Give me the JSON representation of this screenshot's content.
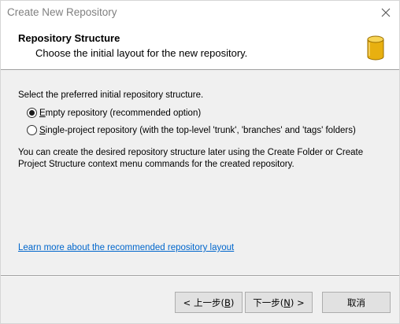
{
  "window": {
    "title": "Create New Repository",
    "close_icon": "close-icon"
  },
  "header": {
    "title": "Repository Structure",
    "subtitle": "Choose the initial layout for the new repository.",
    "icon": "database-icon",
    "icon_color": "#e8b010"
  },
  "content": {
    "instruction": "Select the preferred initial repository structure.",
    "options": [
      {
        "mnemonic": "E",
        "label_rest": "mpty repository (recommended option)",
        "selected": true
      },
      {
        "mnemonic": "S",
        "label_rest": "ingle-project repository (with the top-level 'trunk', 'branches' and 'tags' folders)",
        "selected": false
      }
    ],
    "note": "You can create the desired repository structure later using the Create Folder or Create Project Structure context menu commands for the created repository.",
    "learn_more_link": "Learn more about the recommended repository layout",
    "link_color": "#0066cc"
  },
  "buttons": {
    "back_pre": "< 上一步(",
    "back_key": "B",
    "back_post": ")",
    "next_pre": "下一步(",
    "next_key": "N",
    "next_post": ") >",
    "cancel": "取消"
  }
}
